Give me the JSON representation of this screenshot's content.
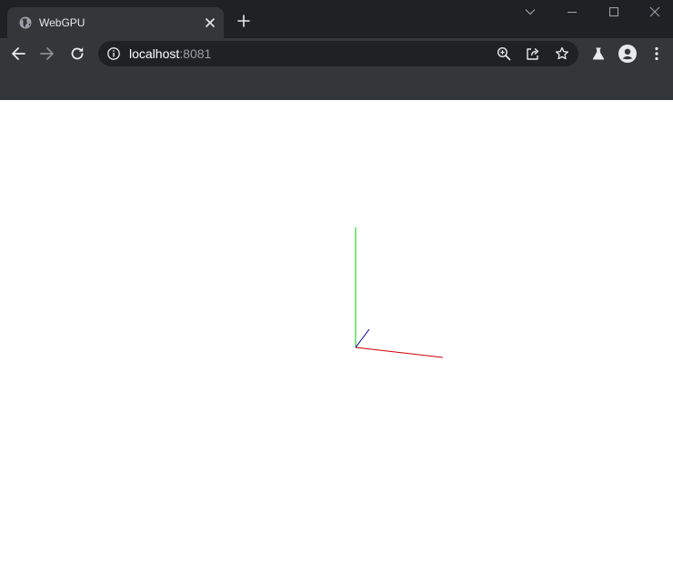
{
  "window": {
    "controls": [
      "tab-search",
      "minimize",
      "maximize",
      "close"
    ]
  },
  "tab": {
    "title": "WebGPU",
    "favicon": "globe-icon",
    "close_icon": "close-icon"
  },
  "new_tab_icon": "plus-icon",
  "toolbar": {
    "back_icon": "arrow-left-icon",
    "forward_icon": "arrow-right-icon",
    "reload_icon": "reload-icon",
    "extensions_icon": "flask-icon",
    "profile_icon": "profile-icon",
    "menu_icon": "kebab-menu-icon"
  },
  "omnibox": {
    "host": "localhost",
    "port": ":8081",
    "info_icon": "info-icon",
    "zoom_icon": "zoom-in-icon",
    "share_icon": "share-icon",
    "bookmark_icon": "star-icon"
  },
  "colors": {
    "tabstrip_bg": "#202124",
    "toolbar_bg": "#35363a",
    "omnibox_bg": "#202124",
    "axis_x": "#cc0000",
    "axis_y": "#00cc00",
    "axis_z": "#000099"
  }
}
